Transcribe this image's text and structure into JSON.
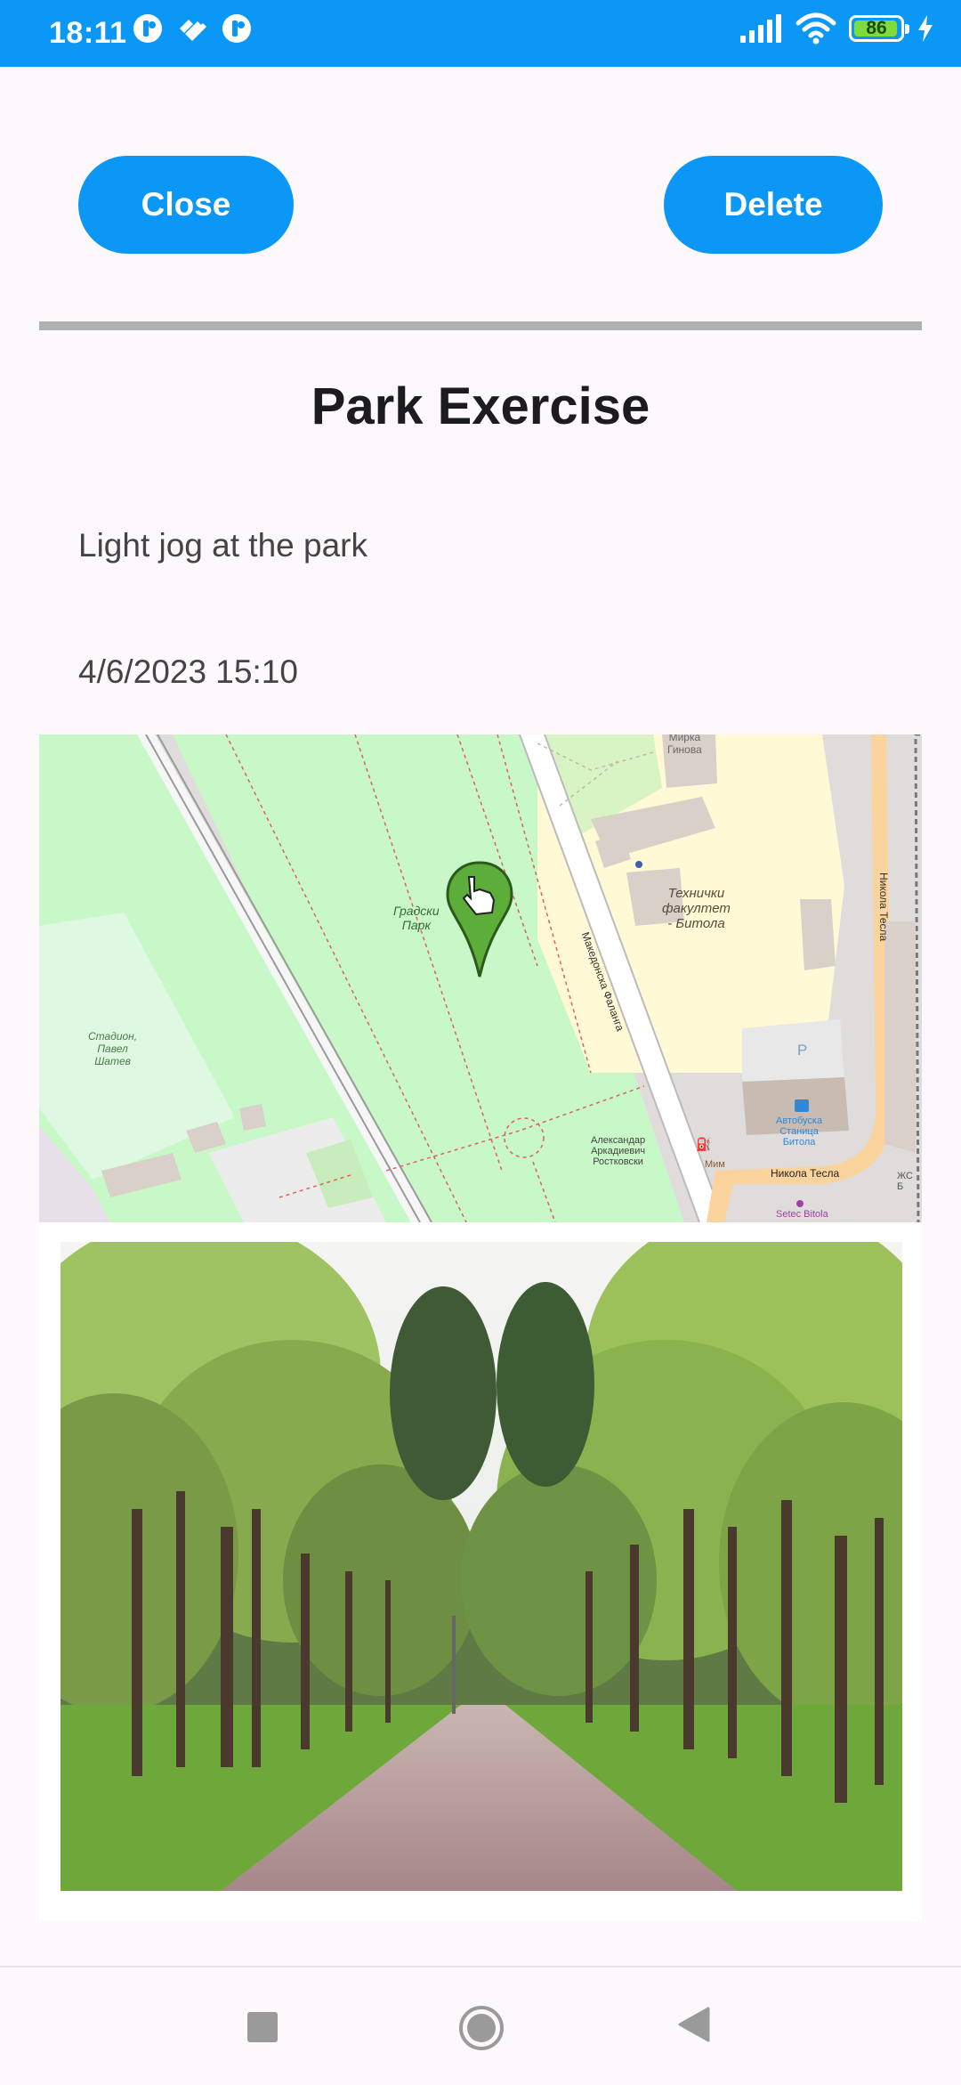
{
  "status_bar": {
    "time": "18:11",
    "battery_level": "86",
    "app_icons": [
      "app-notification-icon",
      "app-notification-icon",
      "app-notification-icon"
    ],
    "indicators": [
      "signal-icon",
      "wifi-icon",
      "battery-icon",
      "charging-icon"
    ]
  },
  "toolbar": {
    "close_label": "Close",
    "delete_label": "Delete"
  },
  "entry": {
    "title": "Park Exercise",
    "description": "Light jog at the park",
    "datetime": "4/6/2023 15:10"
  },
  "map": {
    "labels": {
      "park": "Градски\nПарк",
      "stadium": "Стадион,\nПавел\nШатев",
      "faculty": "Технички\nфакултет\n- Битола",
      "street_makedonska": "Македонска Фаланга",
      "street_nikola_tesla": "Никола Тесла",
      "street_nikola_tesla_2": "Никола Тесла",
      "bus_station": "Автобуска\nСтаница\nБитола",
      "mirka": "Мирка\nГинова",
      "monument": "Александар\nАркадиевич\nРостковски",
      "setec": "Setec Bitola",
      "parking": "P",
      "ms": "Мим",
      "zhs": "ЖС Б"
    },
    "marker_icon": "map-pin-hand-icon"
  },
  "photo": {
    "subject": "park-alley-photo"
  },
  "colors": {
    "accent": "#0a97f5",
    "divider": "#b0b0b0",
    "park_green": "#c8f8c8",
    "marker_green": "#5cad3a"
  }
}
